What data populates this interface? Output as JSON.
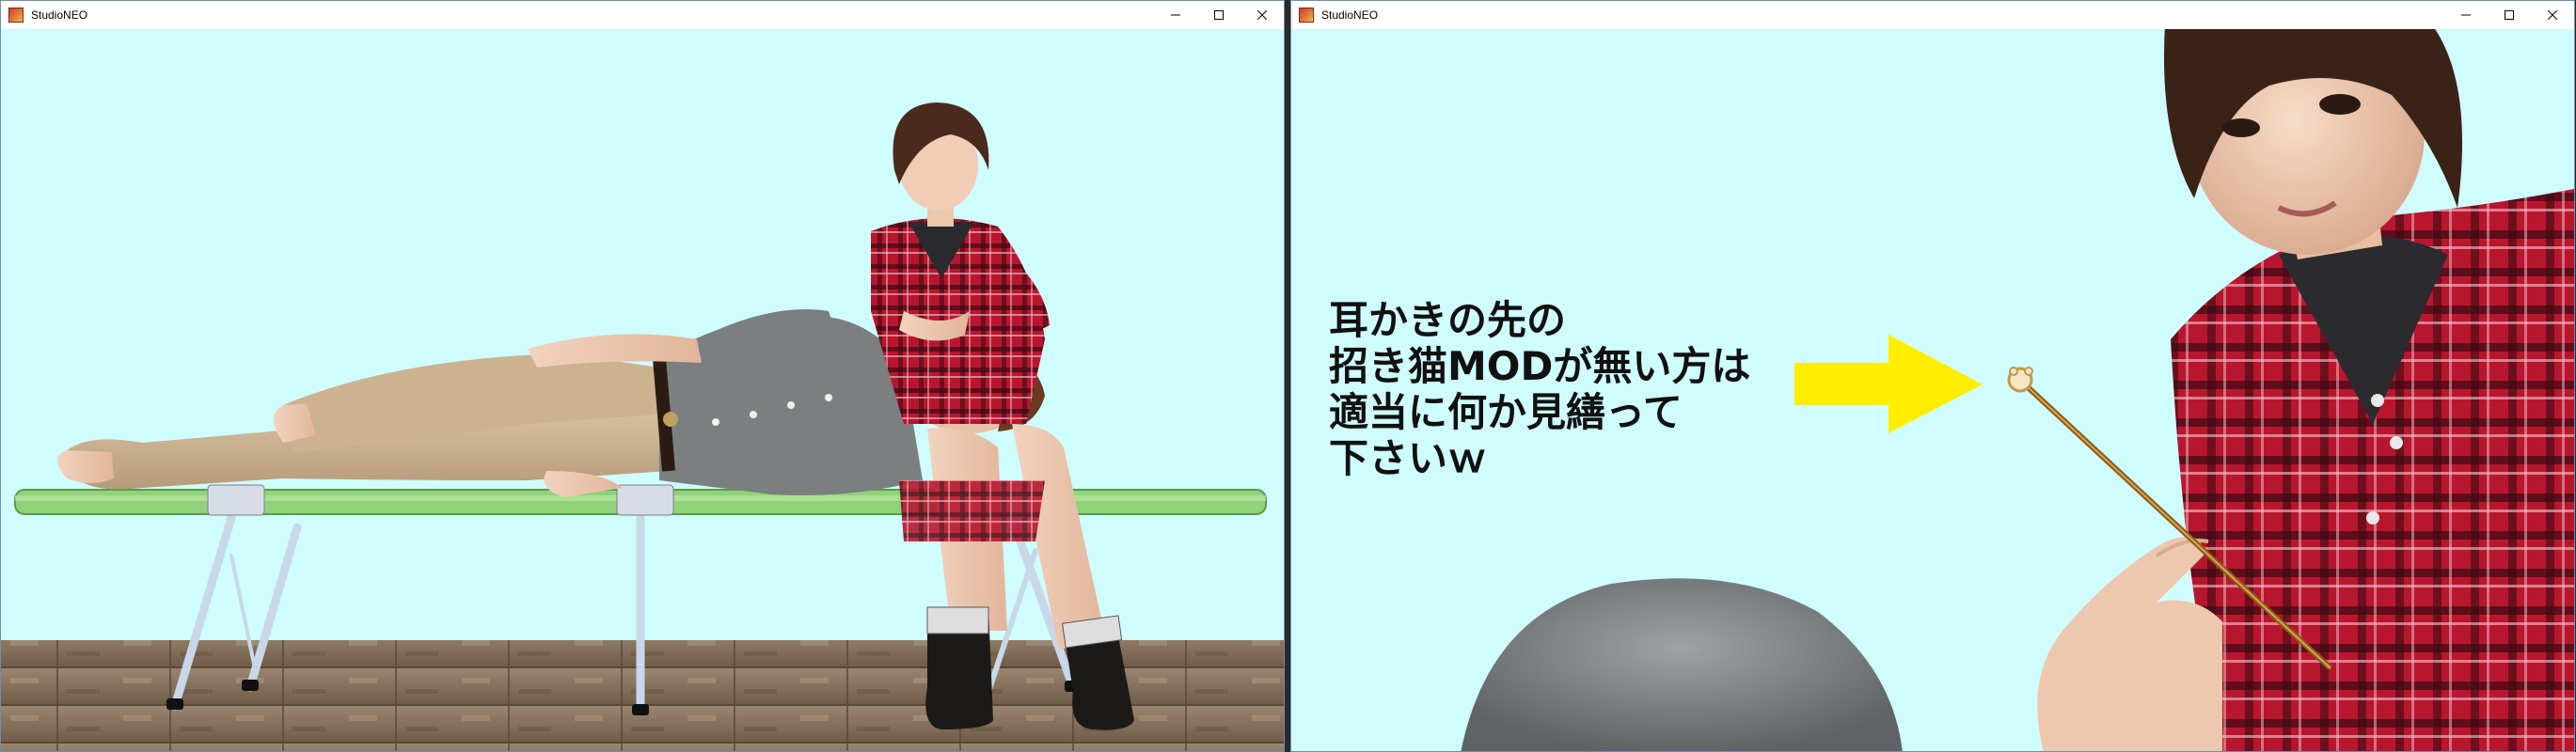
{
  "windows": [
    {
      "title": "StudioNEO",
      "controls": {
        "minimize_icon": "minimize-icon",
        "maximize_icon": "maximize-icon",
        "close_icon": "close-icon"
      },
      "scene": "two characters on a camp cot"
    },
    {
      "title": "StudioNEO",
      "controls": {
        "minimize_icon": "minimize-icon",
        "maximize_icon": "maximize-icon",
        "close_icon": "close-icon"
      },
      "caption_lines": [
        "耳かきの先の",
        "招き猫MODが無い方は",
        "適当に何か見繕って",
        "下さいｗ"
      ]
    }
  ],
  "colors": {
    "sky": "#cffcfd",
    "arrow": "#ffee00",
    "cot_fabric": "#8fd27a",
    "plaid_red": "#b8162e",
    "floor": "#8b7560"
  }
}
